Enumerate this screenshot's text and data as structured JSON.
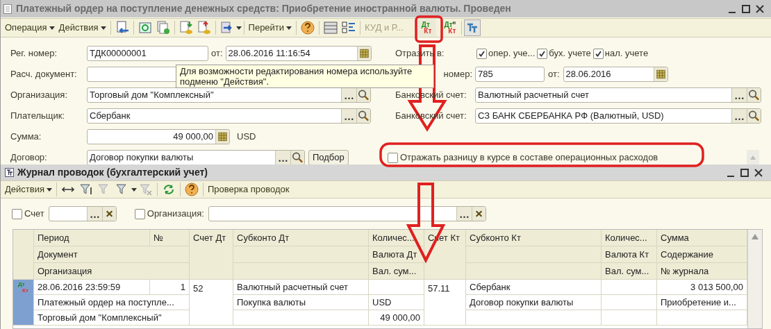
{
  "document_window": {
    "title": "Платежный ордер на поступление денежных средств: Приобретение иностранной валюты. Проведен",
    "toolbar": {
      "operation_menu": "Операция",
      "actions_menu": "Действия",
      "go_menu": "Перейти",
      "kud_button": "КУД и Р...",
      "dtkt_button": {
        "dt": "Дт",
        "kt": "Кт"
      },
      "dtkt_tax_button": {
        "dt": "Дт",
        "sup": "н",
        "kt": "Кт"
      }
    },
    "reg_number": {
      "label": "Рег. номер:",
      "value": "ТДК00000001",
      "date_label": "от:",
      "date": "28.06.2016 11:16:54"
    },
    "payment_document": {
      "label": "Расч. документ:"
    },
    "organization": {
      "label": "Организация:",
      "value": "Торговый дом \"Комплексный\""
    },
    "payer": {
      "label": "Плательщик:",
      "value": "Сбербанк"
    },
    "amount": {
      "label": "Сумма:",
      "value": "49 000,00",
      "currency": "USD"
    },
    "contract": {
      "label": "Договор:",
      "value": "Договор покупки валюты",
      "pick_button": "Подбор"
    },
    "reflect": {
      "label": "Отразить в:",
      "options": [
        {
          "label": "опер. уче...",
          "checked": true
        },
        {
          "label": "бух. учете",
          "checked": true
        },
        {
          "label": "нал. учете",
          "checked": true
        }
      ]
    },
    "incoming_number": {
      "label": "номер:",
      "value": "785",
      "date_label": "от:",
      "date": "28.06.2016"
    },
    "bank_account": {
      "label": "Банковский счет:",
      "value": "Валютный расчетный счет"
    },
    "payer_bank_account": {
      "label": "Банковский счет:",
      "value": "СЗ БАНК СБЕРБАНКА РФ (Валютный, USD)"
    },
    "exchange_difference": {
      "label": "Отражать разницу в курсе в составе операционных расходов",
      "checked": false
    },
    "tooltip": "Для возможности редактирования номера используйте подменю \"Действия\"."
  },
  "journal_window": {
    "title": "Журнал проводок (бухгалтерский учет)",
    "toolbar": {
      "actions_menu": "Действия",
      "check_button": "Проверка проводок"
    },
    "filters": [
      {
        "label": "Счет",
        "checked": false
      },
      {
        "label": "Организация:",
        "checked": false
      }
    ],
    "table": {
      "header": {
        "period": "Период",
        "number": "№",
        "document": "Документ",
        "organization": "Организация",
        "account_dt": "Счет Дт",
        "subconto_dt": "Субконто Дт",
        "qty_dt": "Количес...",
        "currency_dt": "Валюта Дт",
        "cur_sum_dt": "Вал. сум...",
        "account_kt": "Счет Кт",
        "subconto_kt": "Субконто Кт",
        "qty_kt": "Количес...",
        "currency_kt": "Валюта Кт",
        "cur_sum_kt": "Вал. сум...",
        "sum": "Сумма",
        "content": "Содержание",
        "journal": "№ журнала"
      },
      "rows": [
        {
          "icon": {
            "dt": "Дт",
            "kt": "Кт"
          },
          "period": "28.06.2016 23:59:59",
          "number": "1",
          "document": "Платежный ордер на поступле...",
          "organization": "Торговый дом \"Комплексный\"",
          "account_dt": "52",
          "subconto_dt_1": "Валютный расчетный счет",
          "subconto_dt_2": "Покупка валюты",
          "currency_dt": "USD",
          "cur_sum_dt": "49 000,00",
          "account_kt": "57.11",
          "subconto_kt_1": "Сбербанк",
          "subconto_kt_2": "Договор покупки валюты",
          "sum": "3 013 500,00",
          "content": "Приобретение и...",
          "selected": true
        }
      ]
    }
  }
}
